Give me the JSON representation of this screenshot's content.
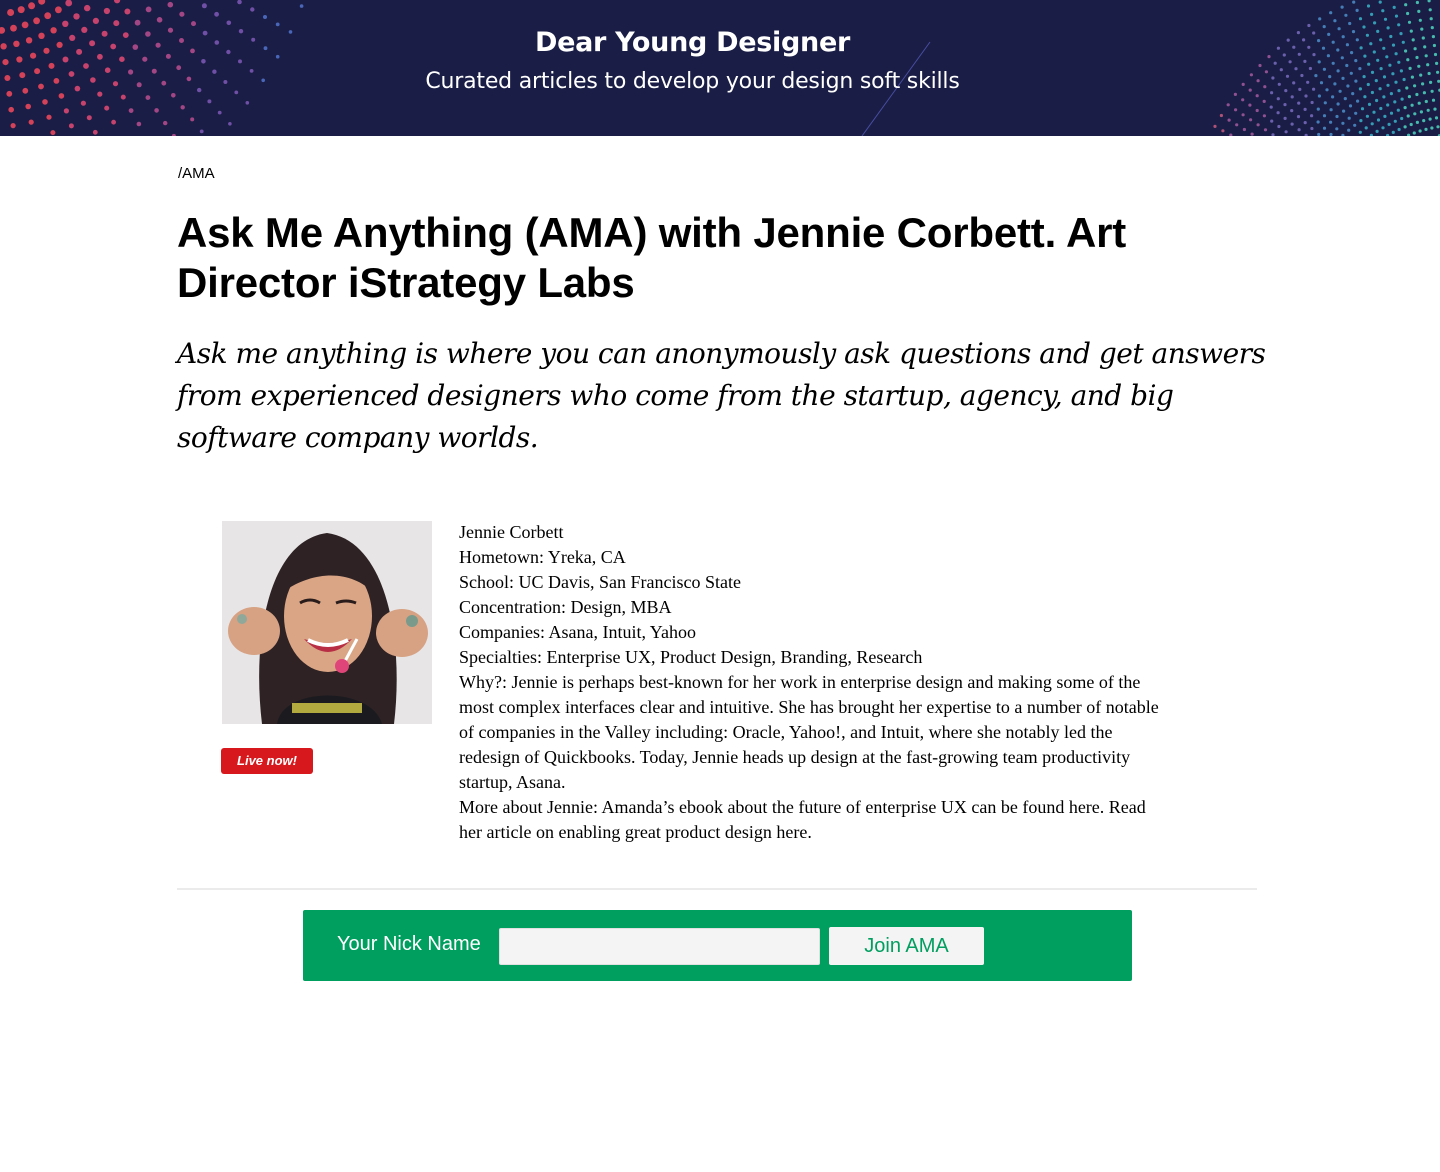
{
  "header": {
    "title": "Dear Young Designer",
    "subtitle": "Curated articles to develop your design soft skills"
  },
  "breadcrumb": "/AMA",
  "page_title": "Ask Me Anything (AMA) with Jennie Corbett. Art Director iStrategy Labs",
  "intro": "Ask me anything is where you can anonymously ask questions and get answers from experienced designers who come from the startup, agency, and big software company worlds.",
  "badge": "Live now!",
  "bio": {
    "name": "Jennie Corbett",
    "hometown": "Hometown: Yreka, CA",
    "school": "School: UC Davis, San Francisco State",
    "concentration": "Concentration: Design, MBA",
    "companies": "Companies: Asana, Intuit, Yahoo",
    "specialties": "Specialties: Enterprise UX, Product Design, Branding, Research",
    "why": "Why?: Jennie is perhaps best-known for her work in enterprise design and making some of the most complex interfaces clear and intuitive. She has brought her expertise to a number of notable of companies in the Valley including: Oracle, Yahoo!, and Intuit, where she notably led the redesign of Quickbooks. Today, Jennie heads up design at the fast-growing team productivity startup, Asana.",
    "more": "More about Jennie: Amanda’s ebook about the future of enterprise UX can be found here. Read her article on enabling great product design here."
  },
  "join": {
    "label": "Your Nick Name",
    "input_value": "",
    "button": "Join AMA"
  },
  "colors": {
    "banner_bg": "#1a1d45",
    "join_bar": "#009e5f",
    "live_badge": "#d7181d"
  }
}
